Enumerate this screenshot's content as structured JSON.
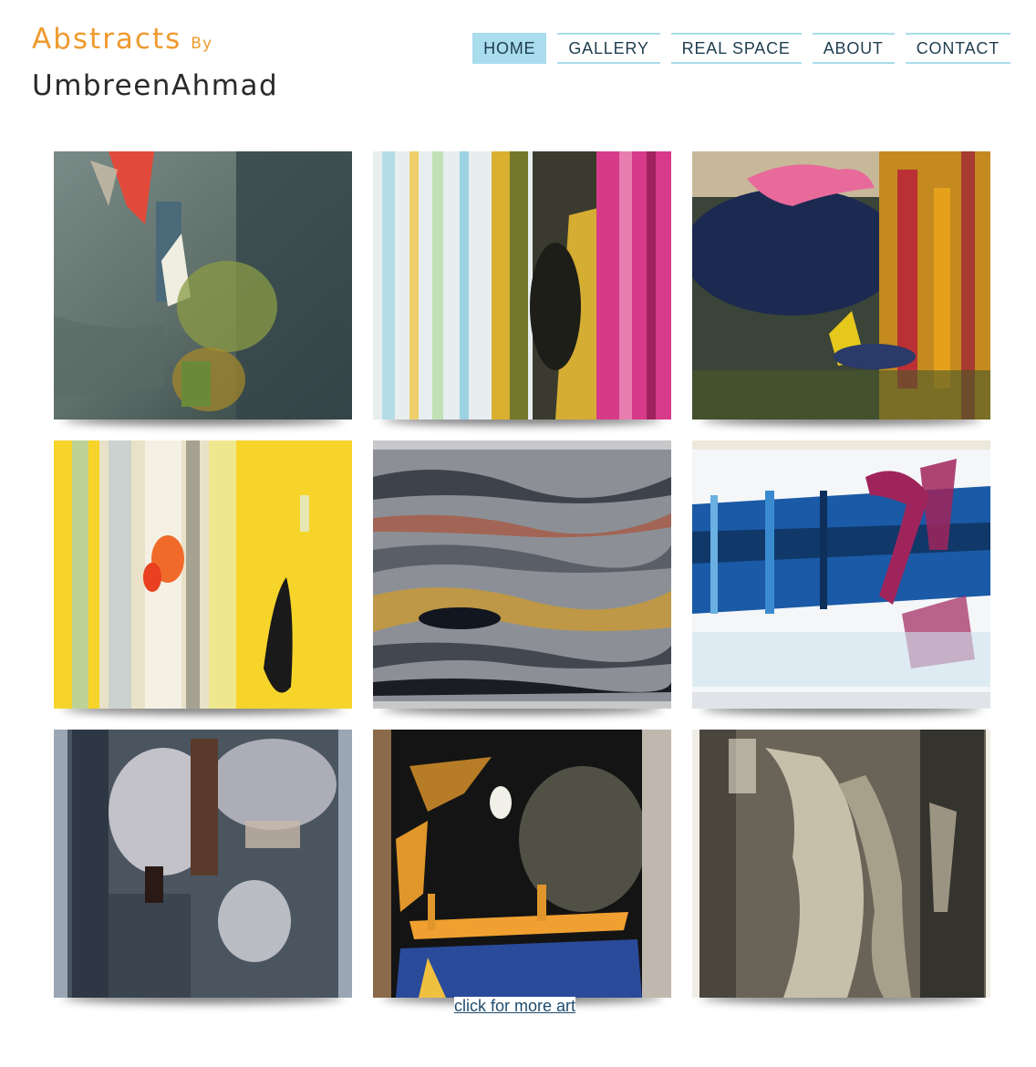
{
  "logo": {
    "title": "Abstracts",
    "by": "By",
    "name": "UmbreenAhmad",
    "colors": {
      "title": "#ef9a2e",
      "name": "#2a2a2a"
    }
  },
  "nav": {
    "items": [
      {
        "label": "HOME",
        "active": true
      },
      {
        "label": "GALLERY",
        "active": false
      },
      {
        "label": "REAL SPACE",
        "active": false
      },
      {
        "label": "ABOUT",
        "active": false
      },
      {
        "label": "CONTACT",
        "active": false
      }
    ],
    "colors": {
      "active_bg": "#a9dced",
      "border": "#aadcec",
      "text": "#1e3d4f"
    }
  },
  "gallery": {
    "paintings": [
      {
        "palette": [
          "#5f6f6a",
          "#3e4c4a",
          "#e14a3a",
          "#8a9b45"
        ]
      },
      {
        "palette": [
          "#e8eef0",
          "#f1c232",
          "#d83a8a",
          "#3a3a2e"
        ]
      },
      {
        "palette": [
          "#2e3a34",
          "#1c2a52",
          "#e86a9a",
          "#e6a11c"
        ]
      },
      {
        "palette": [
          "#e9e2c8",
          "#f6d42a",
          "#f06a2a",
          "#1a1a1a"
        ]
      },
      {
        "palette": [
          "#8c9096",
          "#2b2f38",
          "#c79a3a",
          "#b04a2a"
        ]
      },
      {
        "palette": [
          "#f4f6f8",
          "#1a5aa6",
          "#a0245c",
          "#0e2f5a"
        ]
      },
      {
        "palette": [
          "#4a5560",
          "#d8d6dc",
          "#5a3a2a",
          "#9aa6b4"
        ]
      },
      {
        "palette": [
          "#141414",
          "#e0962a",
          "#2a4a9a",
          "#6a6a5a"
        ]
      },
      {
        "palette": [
          "#6a6458",
          "#d8cfb8",
          "#2a2a26",
          "#a8a08a"
        ]
      }
    ]
  },
  "more_link": {
    "label": "click for more art"
  }
}
